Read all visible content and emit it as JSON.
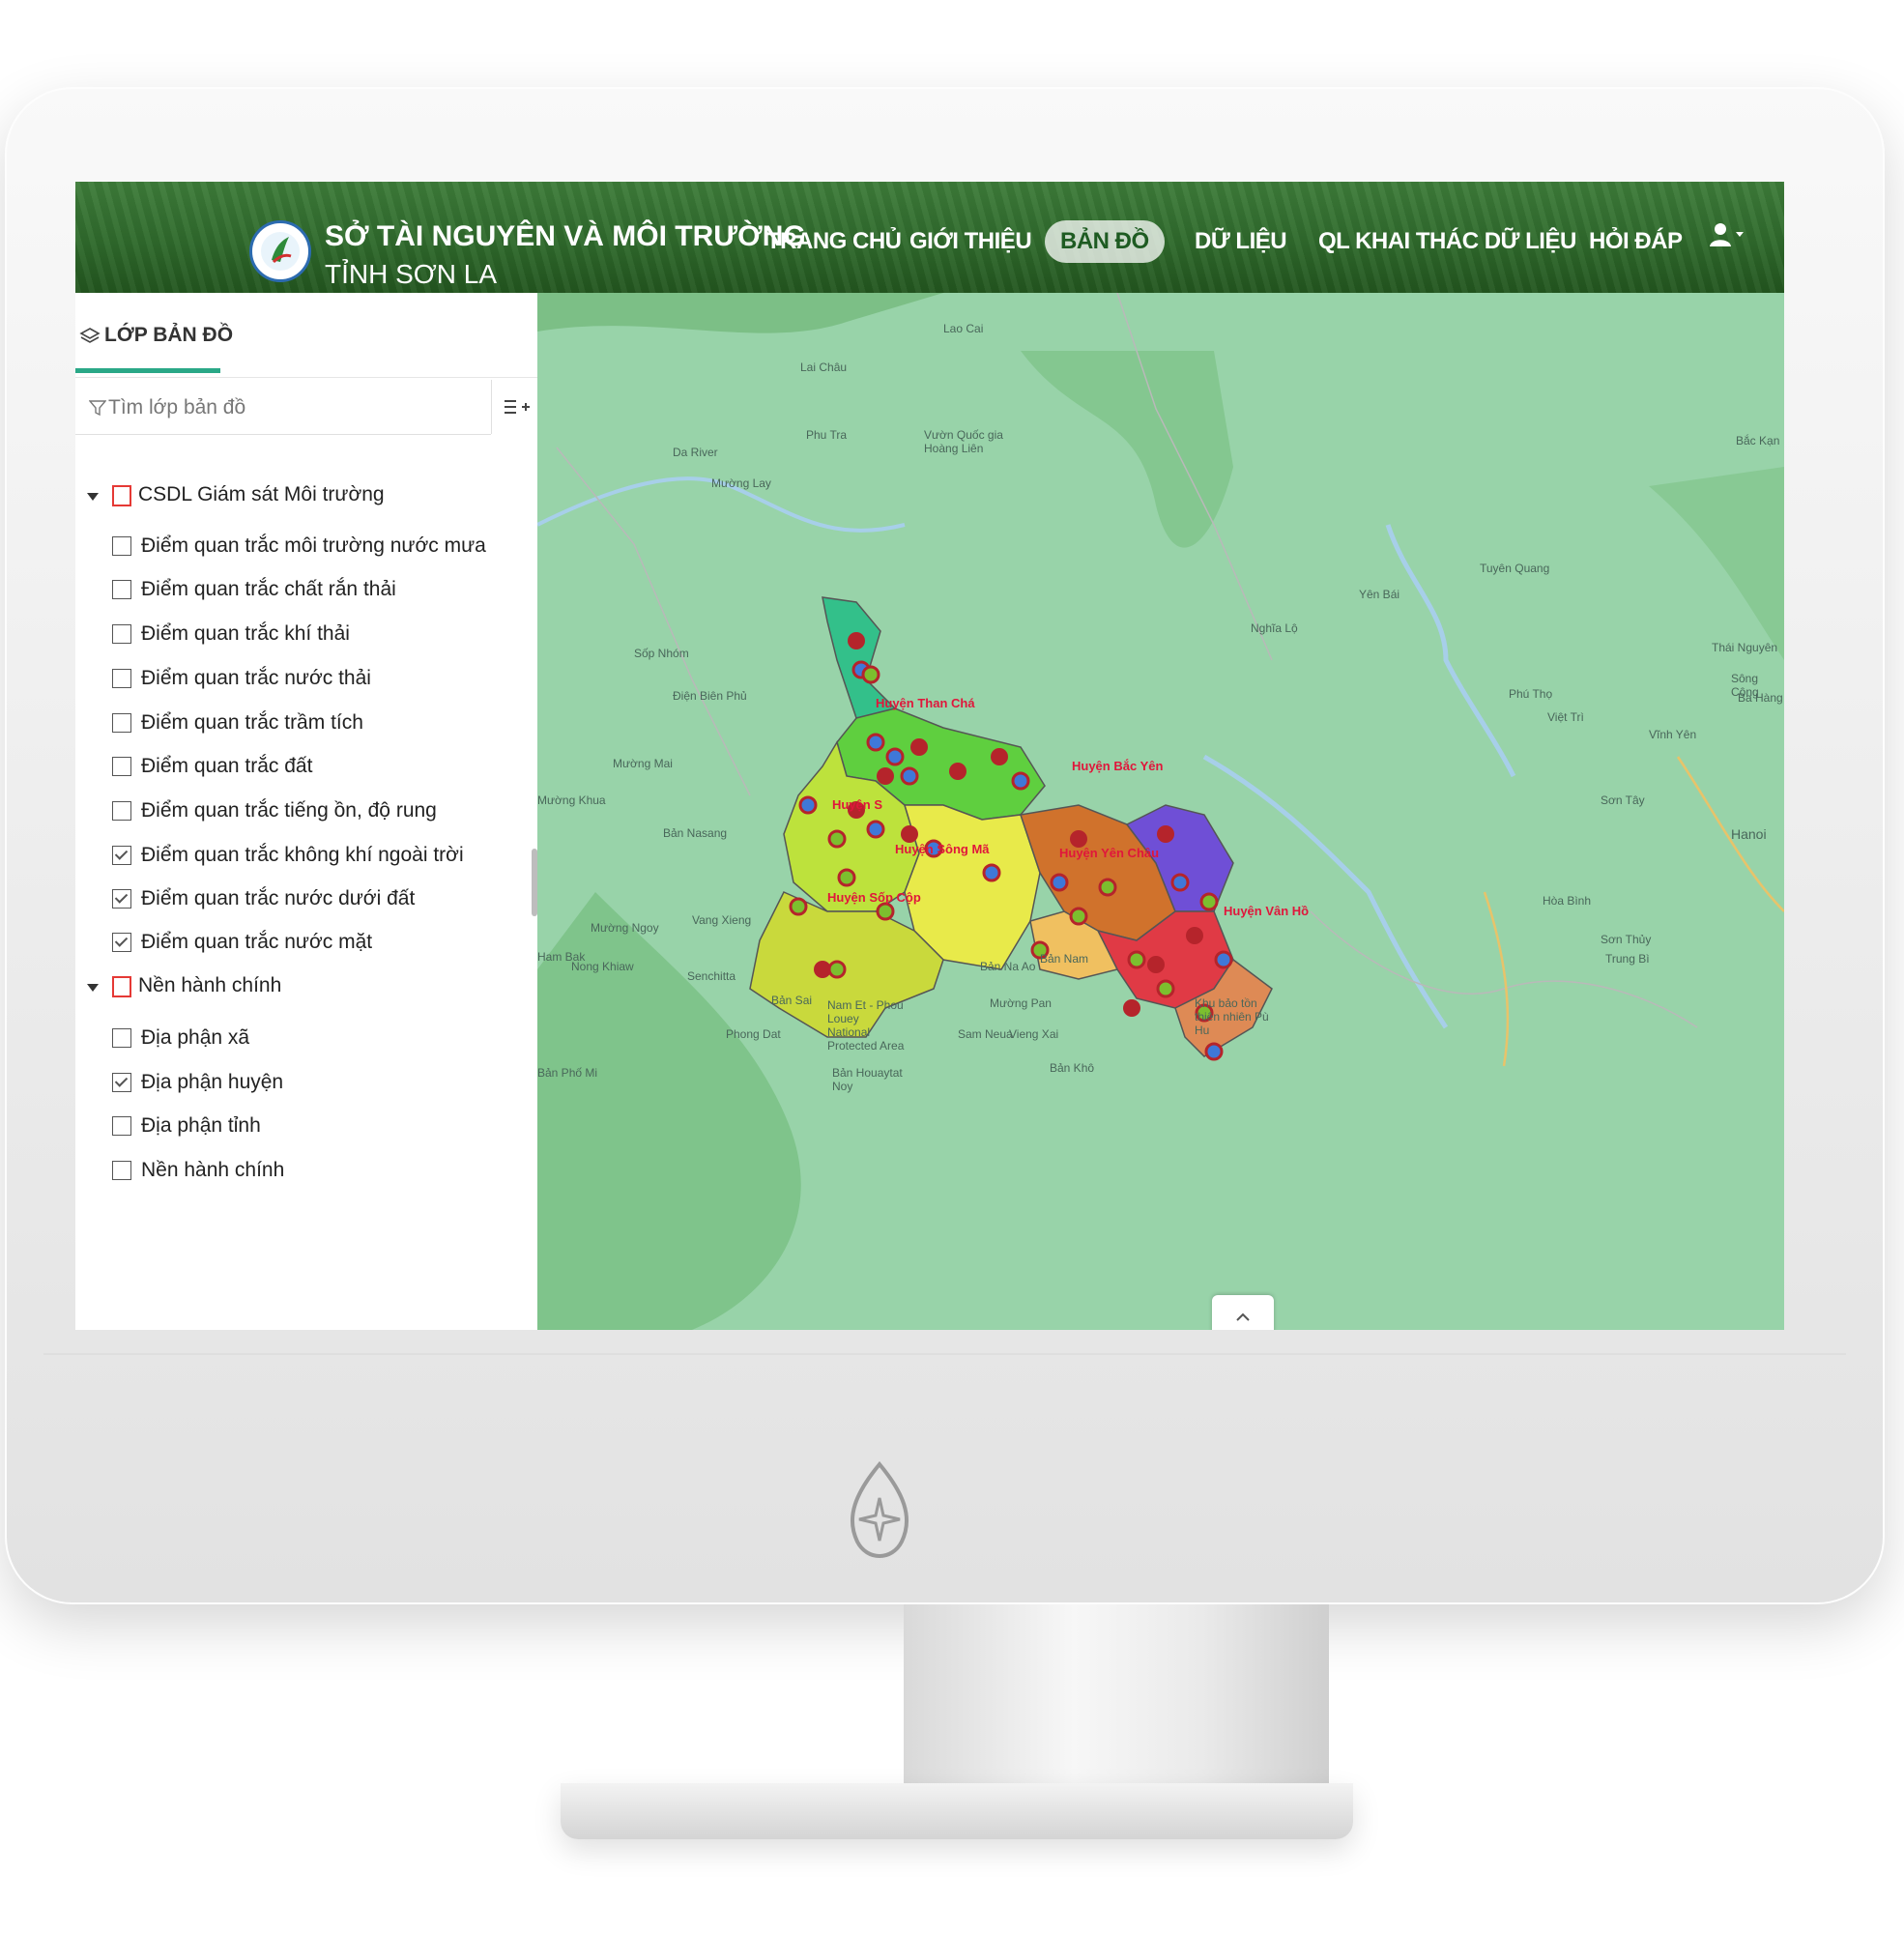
{
  "header": {
    "org_name": "SỞ TÀI NGUYÊN VÀ MÔI TRƯỜNG",
    "org_sub": "TỈNH SƠN LA",
    "nav": [
      "TRANG CHỦ",
      "GIỚI THIỆU",
      "BẢN ĐỒ",
      "DỮ LIỆU",
      "QL KHAI THÁC DỮ LIỆU",
      "HỎI ĐÁP"
    ],
    "active_nav": "BẢN ĐỒ"
  },
  "sidebar": {
    "title": "LỚP BẢN ĐỒ",
    "search_placeholder": "Tìm lớp bản đồ",
    "groups": [
      {
        "label": "CSDL Giám sát Môi trường",
        "items": [
          {
            "label": "Điểm quan trắc môi trường nước mưa",
            "checked": false
          },
          {
            "label": "Điểm quan trắc chất rắn thải",
            "checked": false
          },
          {
            "label": "Điểm quan trắc khí thải",
            "checked": false
          },
          {
            "label": "Điểm quan trắc nước thải",
            "checked": false
          },
          {
            "label": "Điểm quan trắc trầm tích",
            "checked": false
          },
          {
            "label": "Điểm quan trắc đất",
            "checked": false
          },
          {
            "label": "Điểm quan trắc tiếng ồn, độ rung",
            "checked": false
          },
          {
            "label": "Điểm quan trắc không khí ngoài trời",
            "checked": true
          },
          {
            "label": "Điểm quan trắc nước dưới đất",
            "checked": true
          },
          {
            "label": "Điểm quan trắc nước mặt",
            "checked": true
          }
        ]
      },
      {
        "label": "Nền hành chính",
        "items": [
          {
            "label": "Địa phận xã",
            "checked": false
          },
          {
            "label": "Địa phận huyện",
            "checked": true
          },
          {
            "label": "Địa phận tỉnh",
            "checked": false
          },
          {
            "label": "Nền hành chính",
            "checked": false
          }
        ]
      }
    ]
  },
  "map": {
    "place_labels": [
      "Lao Cai",
      "Lai Châu",
      "Phu Tra",
      "Vườn Quốc gia Hoàng Liên",
      "Da River",
      "Mường Lay",
      "Yên Bái",
      "Tuyên Quang",
      "Thái Nguyên",
      "Nghĩa Lộ",
      "Phú Thọ",
      "Việt Trì",
      "Vĩnh Yên",
      "Hanoi",
      "Sơn Tây",
      "Hòa Bình",
      "Bắc Kạn",
      "Sốp Nhóm",
      "Điện Biên Phủ",
      "Mường Mai",
      "Mường Khua",
      "Bản Nasang",
      "Vang Xieng",
      "Mường Ngoy",
      "Nong Khiaw",
      "Senchitta",
      "Bản Sai",
      "Phong Dat",
      "Nam Et - Phou Louey National Protected Area",
      "Bản Houaytat Noy",
      "Mường Pan",
      "Bản Na Ao",
      "Sam Neua",
      "Vieng Xai",
      "Bản Khô",
      "Khu bảo tồn thiên nhiên Pù Hu",
      "Sơn Thủy",
      "Trung Bì",
      "Sông Công",
      "Ba Hàng",
      "Bản Phố Mi",
      "Ham Bak",
      "Bản Nam"
    ],
    "district_labels": [
      "Huyện S",
      "Huyện Than Chá",
      "Huyện Sông Mã",
      "Huyện Sốp Cộp",
      "Huyện Bắc Yên",
      "Huyện Yên Châu",
      "Huyện Vân Hồ"
    ],
    "district_colors": [
      "#33c08a",
      "#5fcf3f",
      "#bde23c",
      "#e8ea4a",
      "#c9d93c",
      "#d0722c",
      "#6f4fd6",
      "#e03a45",
      "#de8a55",
      "#f0c060"
    ],
    "marker_colors": {
      "surface_water": "#b5242b",
      "groundwater_icon": "#3f78d8",
      "air_icon": "#7cbf2e"
    }
  }
}
